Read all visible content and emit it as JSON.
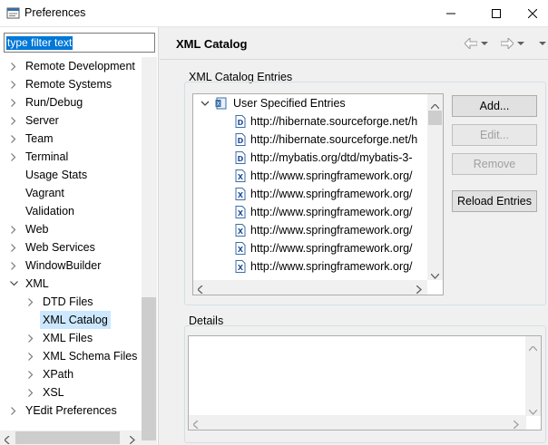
{
  "window": {
    "title": "Preferences"
  },
  "filter": {
    "text": "type filter text"
  },
  "tree": [
    {
      "label": "Remote Development",
      "level": 0,
      "expandable": true,
      "expanded": false
    },
    {
      "label": "Remote Systems",
      "level": 0,
      "expandable": true,
      "expanded": false
    },
    {
      "label": "Run/Debug",
      "level": 0,
      "expandable": true,
      "expanded": false
    },
    {
      "label": "Server",
      "level": 0,
      "expandable": true,
      "expanded": false
    },
    {
      "label": "Team",
      "level": 0,
      "expandable": true,
      "expanded": false
    },
    {
      "label": "Terminal",
      "level": 0,
      "expandable": true,
      "expanded": false
    },
    {
      "label": "Usage Stats",
      "level": 0,
      "expandable": false
    },
    {
      "label": "Vagrant",
      "level": 0,
      "expandable": false
    },
    {
      "label": "Validation",
      "level": 0,
      "expandable": false
    },
    {
      "label": "Web",
      "level": 0,
      "expandable": true,
      "expanded": false
    },
    {
      "label": "Web Services",
      "level": 0,
      "expandable": true,
      "expanded": false
    },
    {
      "label": "WindowBuilder",
      "level": 0,
      "expandable": true,
      "expanded": false
    },
    {
      "label": "XML",
      "level": 0,
      "expandable": true,
      "expanded": true
    },
    {
      "label": "DTD Files",
      "level": 1,
      "expandable": true,
      "expanded": false
    },
    {
      "label": "XML Catalog",
      "level": 1,
      "expandable": false,
      "selected": true
    },
    {
      "label": "XML Files",
      "level": 1,
      "expandable": true,
      "expanded": false
    },
    {
      "label": "XML Schema Files",
      "level": 1,
      "expandable": true,
      "expanded": false
    },
    {
      "label": "XPath",
      "level": 1,
      "expandable": true,
      "expanded": false
    },
    {
      "label": "XSL",
      "level": 1,
      "expandable": true,
      "expanded": false
    },
    {
      "label": "YEdit Preferences",
      "level": 0,
      "expandable": true,
      "expanded": false
    }
  ],
  "page": {
    "title": "XML Catalog",
    "entries_group_label": "XML Catalog Entries",
    "details_group_label": "Details",
    "root_entry": "User Specified Entries",
    "entries": [
      {
        "text": "http://hibernate.sourceforge.net/h",
        "icon": "dtd"
      },
      {
        "text": "http://hibernate.sourceforge.net/h",
        "icon": "dtd"
      },
      {
        "text": "http://mybatis.org/dtd/mybatis-3-",
        "icon": "dtd"
      },
      {
        "text": "http://www.springframework.org/",
        "icon": "xsd"
      },
      {
        "text": "http://www.springframework.org/",
        "icon": "xsd"
      },
      {
        "text": "http://www.springframework.org/",
        "icon": "xsd"
      },
      {
        "text": "http://www.springframework.org/",
        "icon": "xsd"
      },
      {
        "text": "http://www.springframework.org/",
        "icon": "xsd"
      },
      {
        "text": "http://www.springframework.org/",
        "icon": "xsd"
      }
    ],
    "buttons": {
      "add": "Add...",
      "edit": "Edit...",
      "remove": "Remove",
      "reload": "Reload Entries"
    }
  },
  "colors": {
    "selection": "#0078d7",
    "tree_selected": "#cce8ff",
    "disabled_text": "#a0a0a0"
  }
}
